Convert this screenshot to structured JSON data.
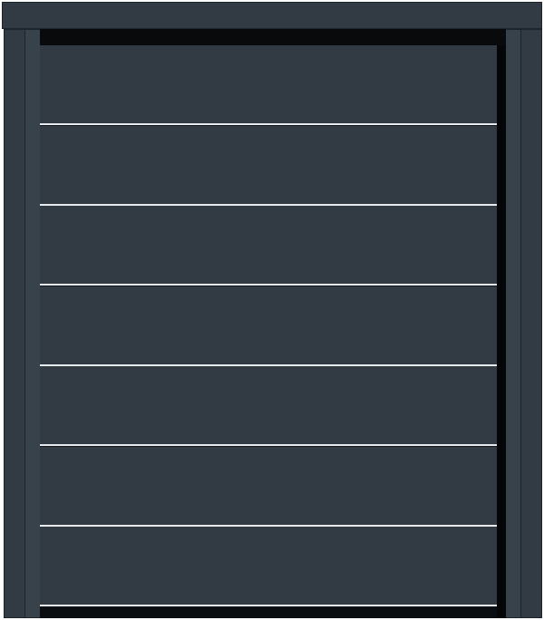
{
  "scene": {
    "description_level": "visual-only",
    "object_type": "garage-door",
    "panel_count": 7,
    "colors": {
      "frame": "#323b43",
      "panel": "#323b43",
      "edge": "#1d252c",
      "shadow": "#080a0c",
      "seam": "#e8ebee"
    }
  }
}
